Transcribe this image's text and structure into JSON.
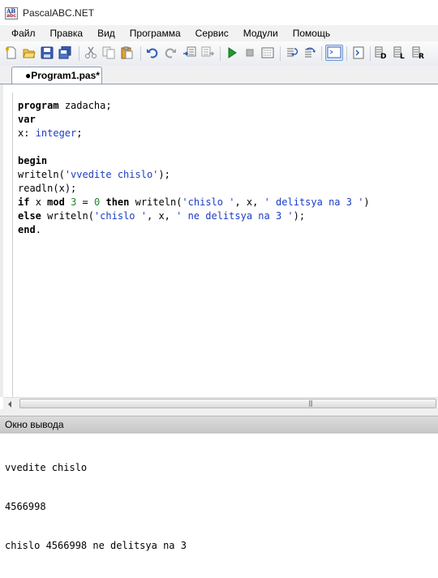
{
  "window": {
    "title": "PascalABC.NET",
    "icon": "pascalabc-app-icon"
  },
  "menu": [
    "Файл",
    "Правка",
    "Вид",
    "Программа",
    "Сервис",
    "Модули",
    "Помощь"
  ],
  "toolbar": {
    "icons": [
      "new-file-icon",
      "open-folder-icon",
      "save-icon",
      "save-all-icon",
      "cut-icon",
      "copy-icon",
      "paste-icon",
      "undo-icon",
      "redo-icon",
      "uncomment-icon",
      "comment-icon",
      "run-icon",
      "stop-icon",
      "compile-icon",
      "step-into-icon",
      "step-over-icon",
      "output-window-icon",
      "debug-view-icon",
      "format-d-icon",
      "format-l-icon",
      "format-r-icon"
    ]
  },
  "tab": {
    "label": "●Program1.pas*"
  },
  "code_lines": [
    "program zadacha;",
    "var",
    "x: integer;",
    "",
    "begin",
    "writeln('vvedite chislo');",
    "readln(x);",
    "if x mod 3 = 0 then writeln('chislo ', x, ' delitsya na 3 ')",
    "else writeln('chislo ', x, ' ne delitsya na 3 ');",
    "end."
  ],
  "output": {
    "title": "Окно вывода",
    "lines": [
      "vvedite chislo",
      "4566998",
      "chislo 4566998 ne delitsya na 3"
    ]
  },
  "colors": {
    "keyword": "#000000",
    "type": "#1c3cc5",
    "string": "#1c3cc5",
    "number": "#1b8a2a"
  }
}
